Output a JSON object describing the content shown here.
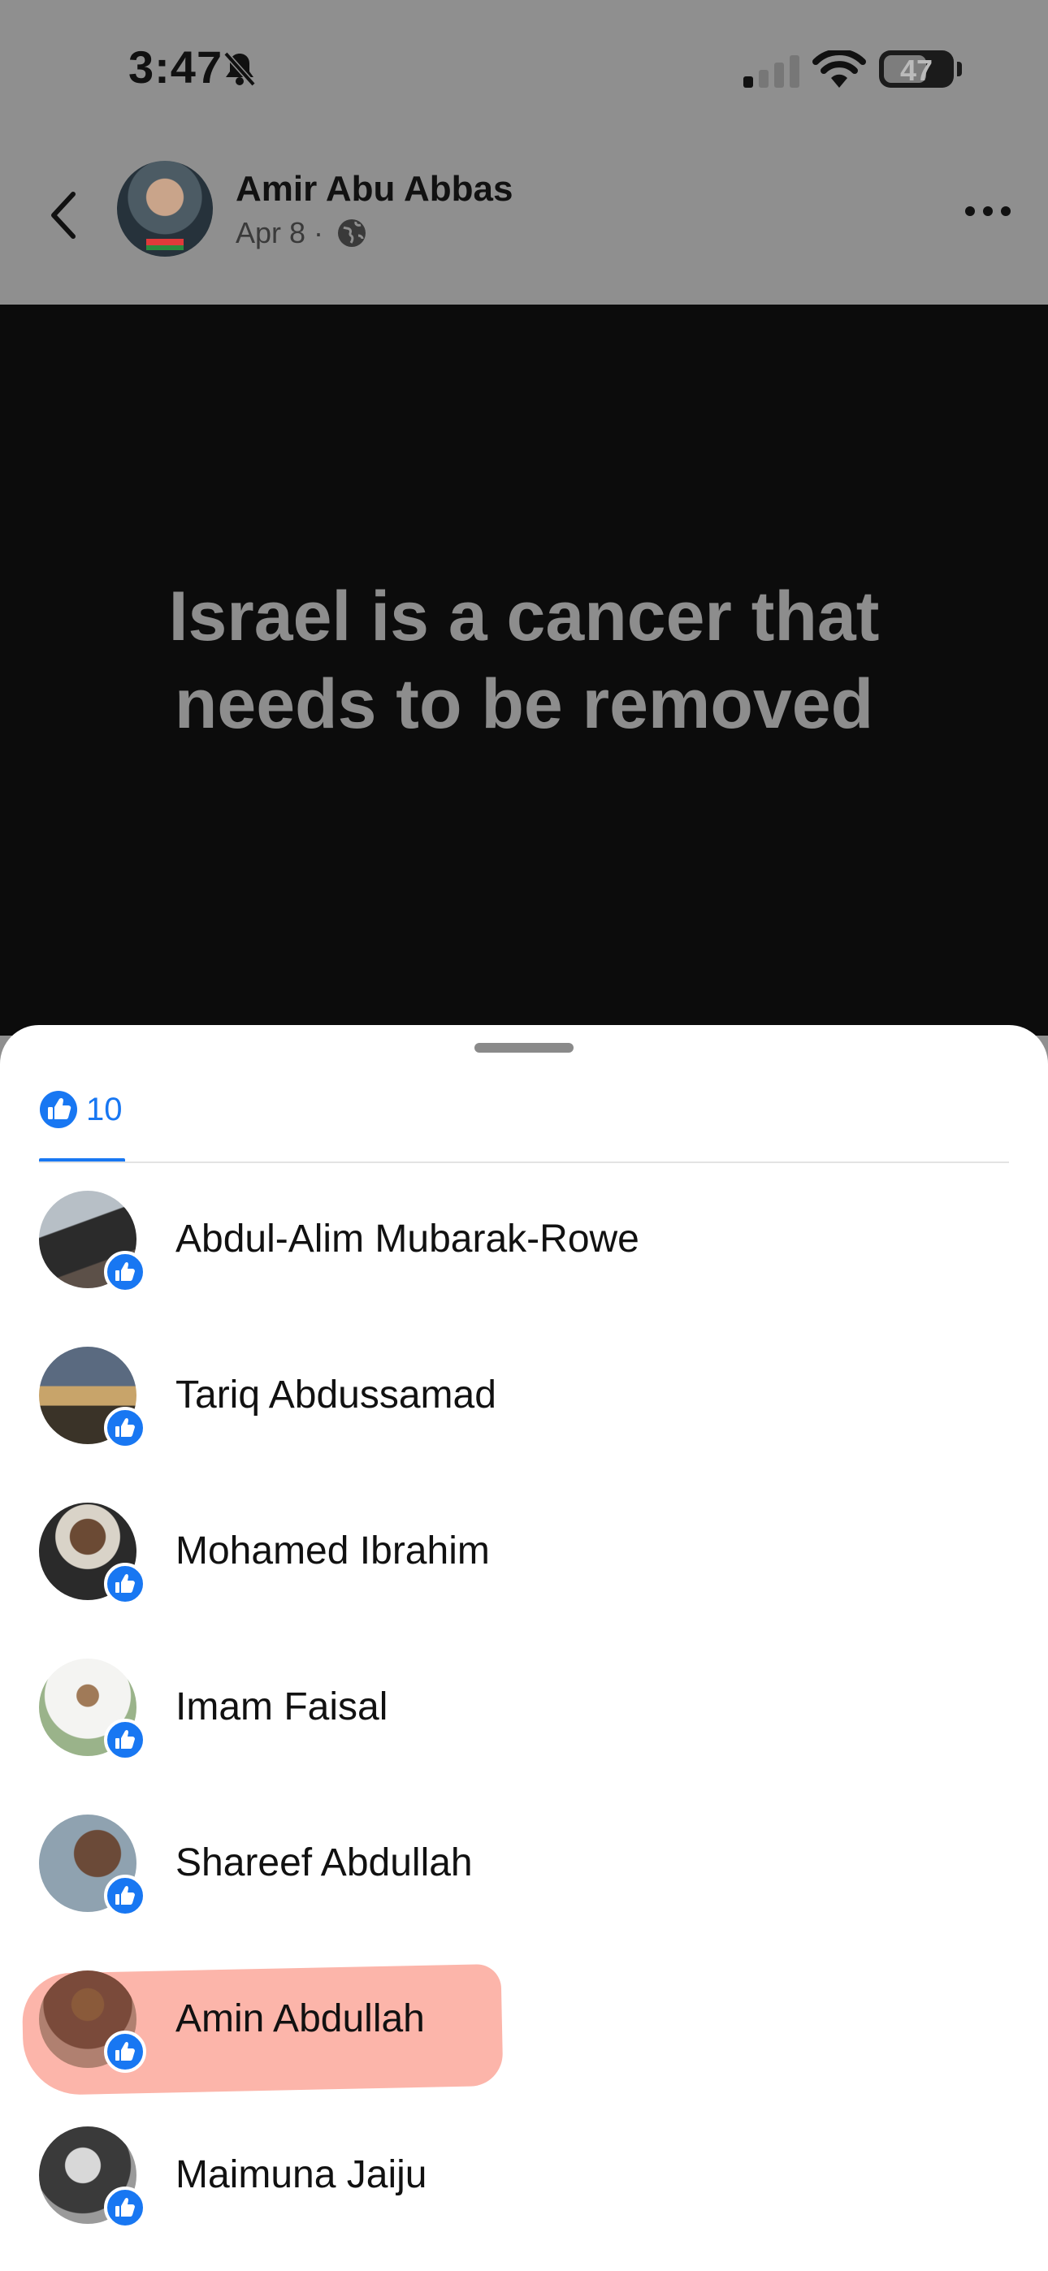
{
  "status_bar": {
    "time": "3:47",
    "battery": "47",
    "icons": [
      "bell-slash-icon",
      "cellular-signal-icon",
      "wifi-icon",
      "battery-icon"
    ]
  },
  "post": {
    "author": "Amir Abu Abbas",
    "date": "Apr 8 ·",
    "audience_icon": "globe-icon",
    "text_line1": "Israel is a cancer that",
    "text_line2": "needs to be removed"
  },
  "reactions_sheet": {
    "tab_count": "10",
    "people": [
      {
        "name": "Abdul-Alim Mubarak-Rowe"
      },
      {
        "name": "Tariq Abdussamad"
      },
      {
        "name": "Mohamed Ibrahim"
      },
      {
        "name": "Imam Faisal"
      },
      {
        "name": "Shareef Abdullah"
      },
      {
        "name": "Amin Abdullah"
      },
      {
        "name": "Maimuna Jaiju"
      }
    ]
  },
  "colors": {
    "accent": "#1877f2",
    "highlight": "#f97a64",
    "post_background": "#0c0c0c",
    "overlay": "#8f8f8f"
  }
}
